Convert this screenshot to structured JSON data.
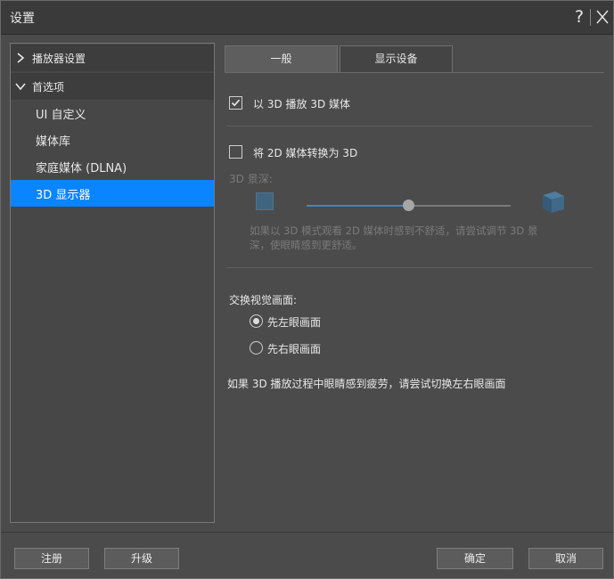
{
  "window": {
    "title": "设置",
    "help_label": "?"
  },
  "sidebar": {
    "groups": [
      {
        "label": "播放器设置",
        "expanded": false
      },
      {
        "label": "首选项",
        "expanded": true
      }
    ],
    "items": [
      {
        "label": "UI 自定义"
      },
      {
        "label": "媒体库"
      },
      {
        "label": "家庭媒体 (DLNA)"
      },
      {
        "label": "3D 显示器",
        "selected": true
      }
    ],
    "selected_color": "#0a84ff"
  },
  "tabs": [
    {
      "label": "一般",
      "active": true
    },
    {
      "label": "显示设备",
      "active": false
    }
  ],
  "general": {
    "play_3d": {
      "label": "以 3D 播放 3D 媒体",
      "checked": true
    },
    "convert_2d": {
      "label": "将 2D 媒体转换为 3D",
      "checked": false
    },
    "depth": {
      "label": "3D 景深:",
      "value_fraction": 0.5,
      "hint": "如果以 3D 模式观看 2D 媒体时感到不舒适，请尝试调节 3D 景深，使眼睛感到更舒适。",
      "hint_line1": "如果以 3D 模式观看 2D 媒体时感到不舒适，请尝试调节 3D 景",
      "hint_line2": "深，使眼睛感到更舒适。",
      "enabled": false
    },
    "swap": {
      "label": "交换视觉画面:",
      "options": [
        {
          "label": "先左眼画面",
          "checked": true
        },
        {
          "label": "先右眼画面",
          "checked": false
        }
      ],
      "hint": "如果 3D 播放过程中眼睛感到疲劳，请尝试切换左右眼画面"
    }
  },
  "footer": {
    "register": "注册",
    "upgrade": "升级",
    "ok": "确定",
    "cancel": "取消"
  }
}
